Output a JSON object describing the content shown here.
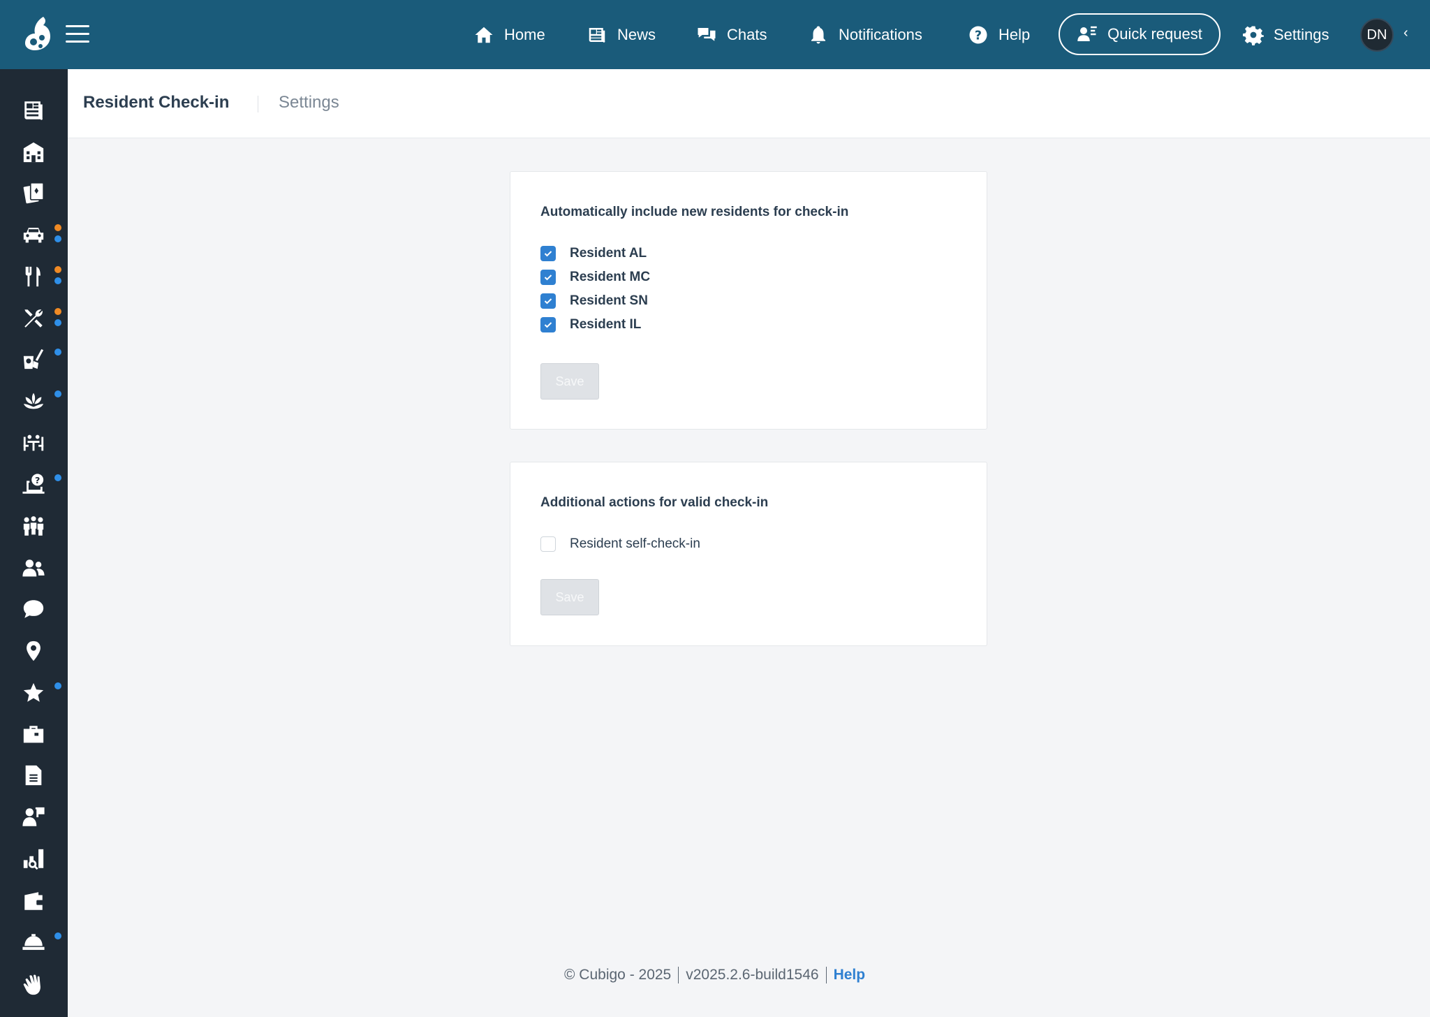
{
  "topbar": {
    "nav": [
      {
        "label": "Home",
        "icon": "home-icon"
      },
      {
        "label": "News",
        "icon": "newspaper-icon"
      },
      {
        "label": "Chats",
        "icon": "chats-icon"
      },
      {
        "label": "Notifications",
        "icon": "bell-icon"
      },
      {
        "label": "Help",
        "icon": "question-circle-icon"
      }
    ],
    "quick_request": "Quick request",
    "settings": "Settings",
    "avatar_initials": "DN"
  },
  "sidebar": {
    "items": [
      {
        "icon": "newspaper-icon",
        "dots": []
      },
      {
        "icon": "building-icon",
        "dots": []
      },
      {
        "icon": "cards-icon",
        "dots": []
      },
      {
        "icon": "car-icon",
        "dots": [
          "orange",
          "blue"
        ]
      },
      {
        "icon": "utensils-icon",
        "dots": [
          "orange",
          "blue"
        ]
      },
      {
        "icon": "tools-icon",
        "dots": [
          "orange",
          "blue"
        ]
      },
      {
        "icon": "cleaning-icon",
        "dots": [
          "blue"
        ]
      },
      {
        "icon": "lotus-icon",
        "dots": [
          "blue"
        ]
      },
      {
        "icon": "dining-table-icon",
        "dots": []
      },
      {
        "icon": "laptop-help-icon",
        "dots": [
          "blue"
        ]
      },
      {
        "icon": "group-icon",
        "dots": []
      },
      {
        "icon": "users-icon",
        "dots": []
      },
      {
        "icon": "comment-icon",
        "dots": []
      },
      {
        "icon": "map-marker-icon",
        "dots": []
      },
      {
        "icon": "star-icon",
        "dots": [
          "blue"
        ]
      },
      {
        "icon": "briefcase-icon",
        "dots": []
      },
      {
        "icon": "document-icon",
        "dots": []
      },
      {
        "icon": "user-flag-icon",
        "dots": []
      },
      {
        "icon": "chart-search-icon",
        "dots": []
      },
      {
        "icon": "wallet-icon",
        "dots": []
      },
      {
        "icon": "service-bell-icon",
        "dots": [
          "blue"
        ]
      },
      {
        "icon": "waving-hand-icon",
        "dots": []
      }
    ]
  },
  "header": {
    "title": "Resident Check-in",
    "tab_settings": "Settings"
  },
  "card1": {
    "title": "Automatically include new residents for check-in",
    "options": [
      {
        "label": "Resident AL",
        "checked": true
      },
      {
        "label": "Resident MC",
        "checked": true
      },
      {
        "label": "Resident SN",
        "checked": true
      },
      {
        "label": "Resident IL",
        "checked": true
      }
    ],
    "save_label": "Save"
  },
  "card2": {
    "title": "Additional actions for valid check-in",
    "options": [
      {
        "label": "Resident self-check-in",
        "checked": false
      }
    ],
    "save_label": "Save"
  },
  "footer": {
    "copyright": "© Cubigo - 2025",
    "version": "v2025.2.6-build1546",
    "help": "Help"
  },
  "colors": {
    "topbar": "#1a5b7a",
    "sidebar": "#1f2a35",
    "accent": "#2f80d1",
    "dot_orange": "#f08a24",
    "dot_blue": "#2f8fe8"
  }
}
